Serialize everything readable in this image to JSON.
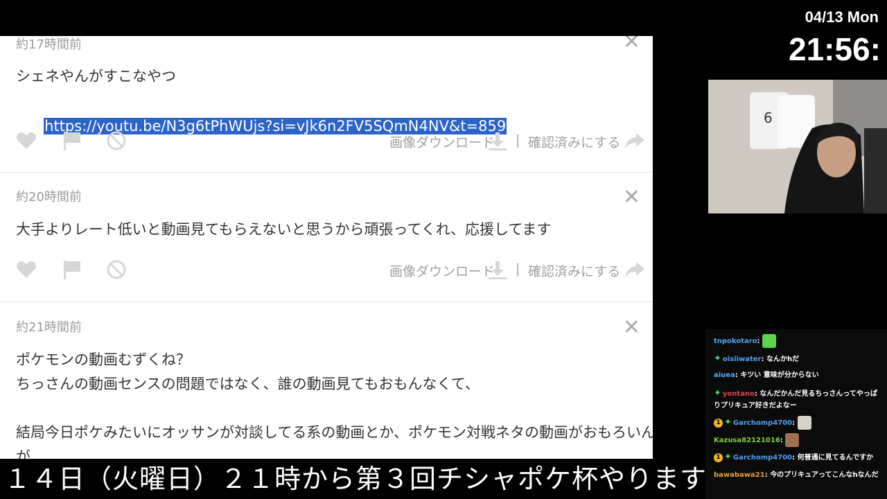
{
  "clock": {
    "date": "04/13 Mon",
    "time": "21:56:"
  },
  "comments": [
    {
      "time": "約17時間前",
      "lines": [
        "シェネやんがすこなやつ"
      ],
      "link": "https://youtu.be/N3g6tPhWUjs?si=vJk6n2FV5SQmN4NV&t=859"
    },
    {
      "time": "約20時間前",
      "lines": [
        "大手よりレート低いと動画見てもらえないと思うから頑張ってくれ、応援してます"
      ]
    },
    {
      "time": "約21時間前",
      "lines": [
        "ポケモンの動画むずくね？",
        "ちっさんの動画センスの問題ではなく、誰の動画見てもおもんなくて、",
        "",
        "結局今日ポケみたいにオッサンが対談してる系の動画とか、ポケモン対戦ネタの動画がおもろいんだ",
        "が..."
      ]
    }
  ],
  "actions": {
    "download_label": "画像ダウンロード",
    "separator": "|",
    "confirm_label": "確認済みにする"
  },
  "close_glyph": "✕",
  "chat": [
    {
      "user": "tnpokotaro",
      "user_color": "#4ea1f5",
      "text": "",
      "badge": "",
      "emote": "green-face"
    },
    {
      "user": "oisiiwater",
      "user_color": "#4ea1f5",
      "text": "なんかhだ",
      "badge": "green"
    },
    {
      "user": "aiuea",
      "user_color": "#5aa8ff",
      "text": "キツい 意味が分からない",
      "badge": ""
    },
    {
      "user": "yontano",
      "user_color": "#e0454b",
      "text": "なんだかんだ見るちっさんってやっぱりプリキュア好きだよなー",
      "badge": "green"
    },
    {
      "user": "Garchomp4700",
      "user_color": "#4ea1f5",
      "text": "",
      "badge": "num-green",
      "badge_num": "1",
      "emote": "cat"
    },
    {
      "user": "Kazusa82121016",
      "user_color": "#76d13f",
      "text": "",
      "badge": "",
      "emote": "face"
    },
    {
      "user": "Garchomp4700",
      "user_color": "#4ea1f5",
      "text": "何普通に見てるんですか",
      "badge": "num-green",
      "badge_num": "1"
    },
    {
      "user": "bawabawa21",
      "user_color": "#e8a23c",
      "text": "今のプリキュアってこんなhなんだ",
      "badge": ""
    }
  ],
  "ticker": "１４日（火曜日）２１時から第３回チシャポケ杯やります"
}
